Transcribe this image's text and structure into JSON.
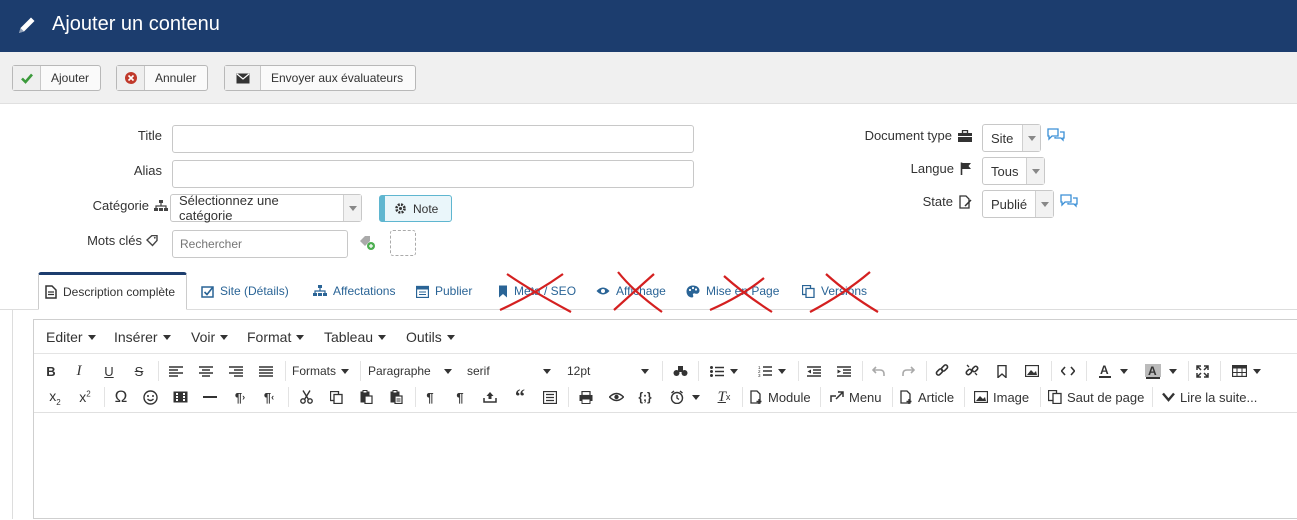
{
  "header": {
    "title": "Ajouter un contenu",
    "icon": "pencil-icon"
  },
  "toolbar": {
    "add_label": "Ajouter",
    "cancel_label": "Annuler",
    "send_label": "Envoyer aux évaluateurs"
  },
  "form": {
    "title_label": "Title",
    "alias_label": "Alias",
    "category_label": "Catégorie",
    "category_value": "Sélectionnez une catégorie",
    "note_label": "Note",
    "keywords_label": "Mots clés",
    "keywords_placeholder": "Rechercher",
    "doctype_label": "Document type",
    "doctype_value": "Site",
    "language_label": "Langue",
    "language_value": "Tous",
    "state_label": "State",
    "state_value": "Publié"
  },
  "tabs": [
    {
      "label": "Description complète",
      "icon": "document-icon",
      "active": true
    },
    {
      "label": "Site (Détails)",
      "icon": "checkbox-icon"
    },
    {
      "label": "Affectations",
      "icon": "sitemap-icon"
    },
    {
      "label": "Publier",
      "icon": "calendar-icon"
    },
    {
      "label": "Meta / SEO",
      "icon": "bookmark-icon",
      "crossed_out": true
    },
    {
      "label": "Affichage",
      "icon": "eye-icon",
      "crossed_out": true
    },
    {
      "label": "Mise en Page",
      "icon": "palette-icon",
      "crossed_out": true
    },
    {
      "label": "Versions",
      "icon": "copy-icon",
      "crossed_out": true
    }
  ],
  "editor": {
    "menus": [
      "Editer",
      "Insérer",
      "Voir",
      "Format",
      "Tableau",
      "Outils"
    ],
    "formats_label": "Formats",
    "block_label": "Paragraphe",
    "font_label": "serif",
    "size_label": "12pt",
    "bold": "B",
    "italic": "I",
    "underline": "U",
    "strike": "S",
    "module_label": "Module",
    "menu_label": "Menu",
    "article_label": "Article",
    "image_label": "Image",
    "pagebreak_label": "Saut de page",
    "readmore_label": "Lire la suite..."
  },
  "colors": {
    "header_bg": "#1c3d6e",
    "link": "#2a6496",
    "cross": "#d42020"
  }
}
